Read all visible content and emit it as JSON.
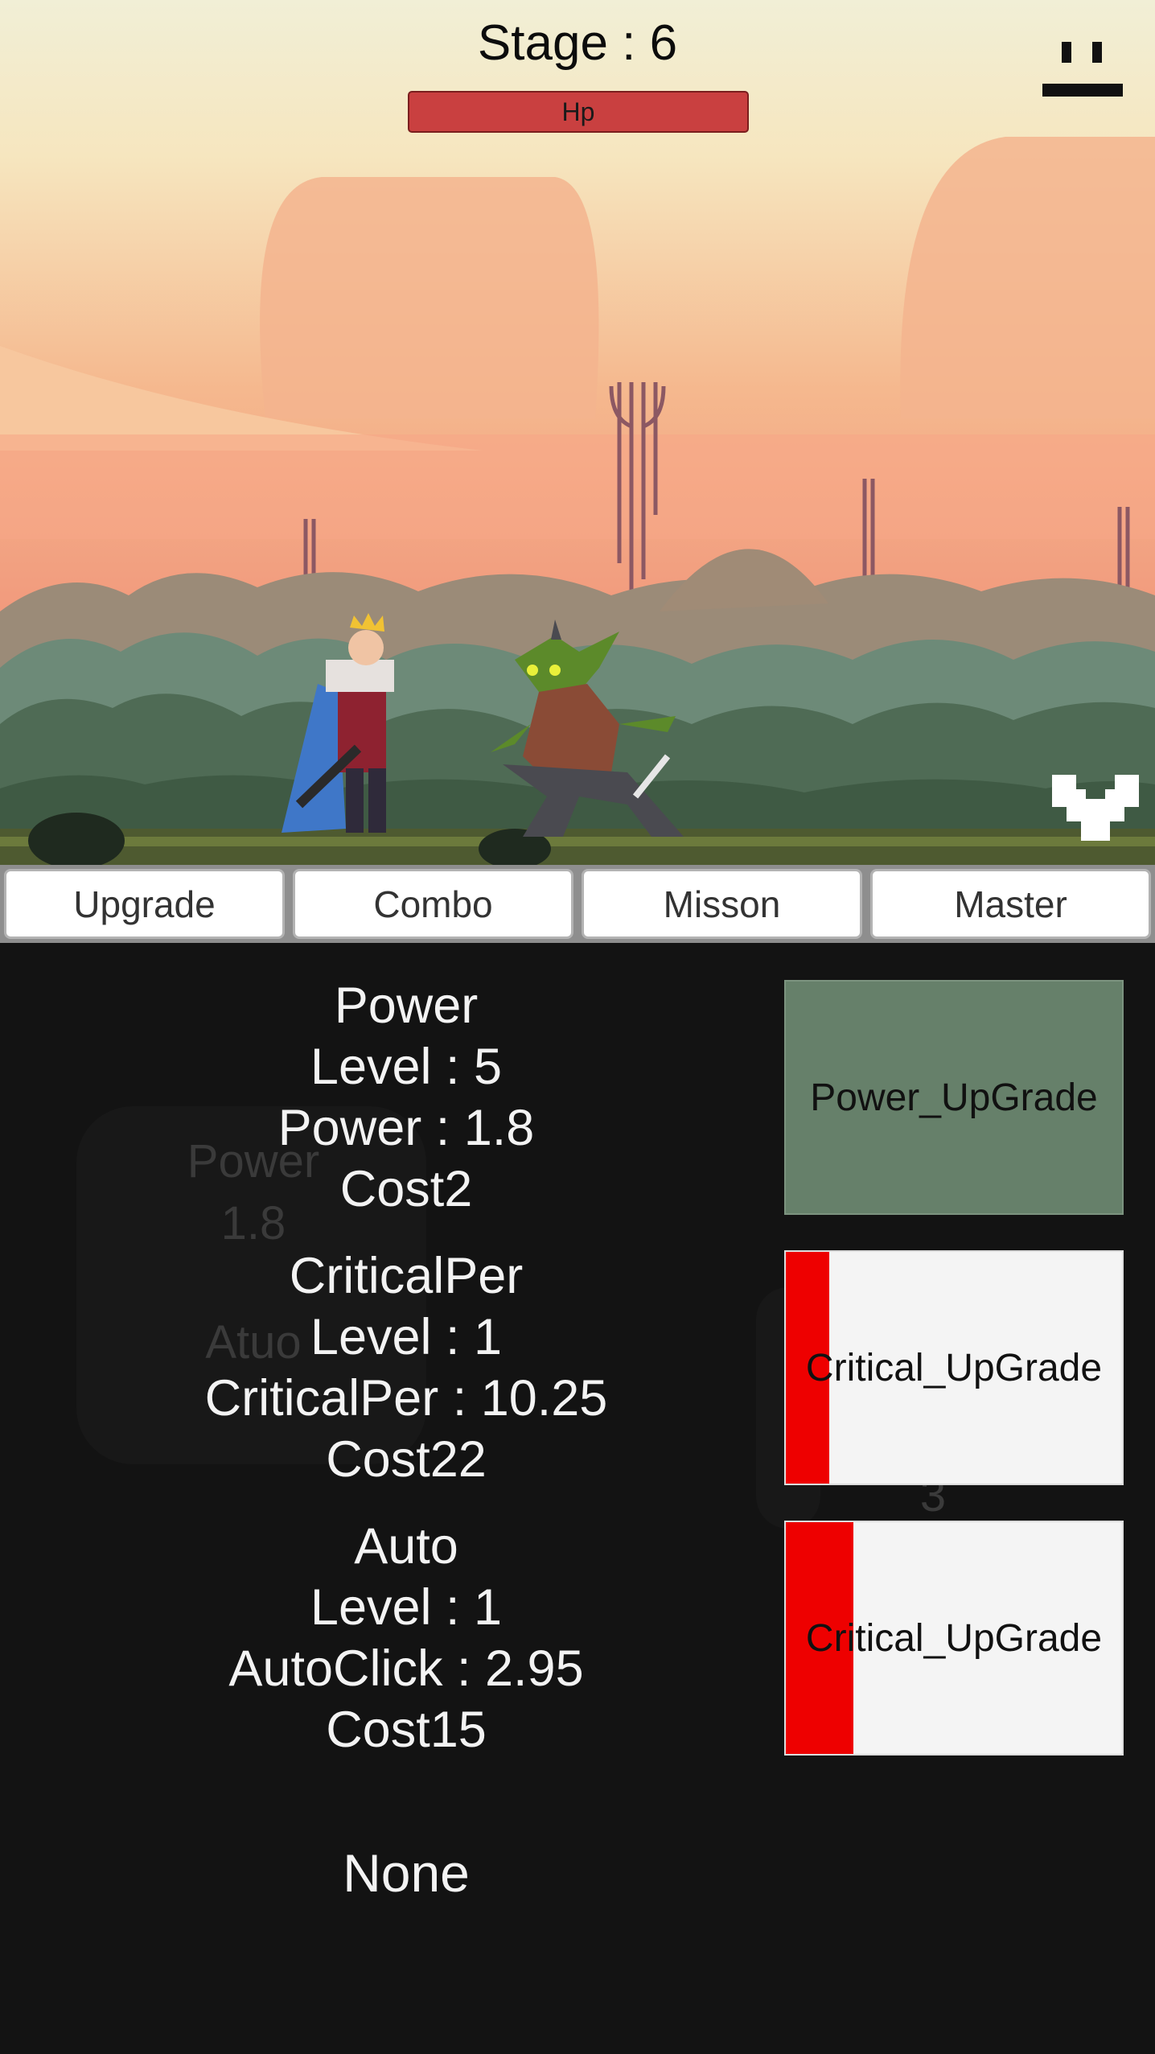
{
  "stage": {
    "label": "Stage : 6"
  },
  "hp": {
    "label": "Hp",
    "fill_fraction": 1.0,
    "color": "#c94040"
  },
  "tabs": [
    {
      "label": "Upgrade"
    },
    {
      "label": "Combo"
    },
    {
      "label": "Misson"
    },
    {
      "label": "Master"
    }
  ],
  "stats": [
    {
      "name": "Power",
      "level": "Level : 5",
      "value": "Power : 1.8",
      "cost": "Cost2"
    },
    {
      "name": "CriticalPer",
      "level": "Level : 1",
      "value": "CriticalPer : 10.25",
      "cost": "Cost22"
    },
    {
      "name": "Auto",
      "level": "Level : 1",
      "value": "AutoClick : 2.95",
      "cost": "Cost15"
    }
  ],
  "upgrade_buttons": [
    {
      "label": "Power_UpGrade",
      "cooldown_fraction": 0.0,
      "bg": "#66806a"
    },
    {
      "label": "Critical_UpGrade",
      "cooldown_fraction": 0.13,
      "bg": "#f4f4f4"
    },
    {
      "label": "Critical_UpGrade",
      "cooldown_fraction": 0.2,
      "bg": "#f4f4f4"
    }
  ],
  "ghost_panel": {
    "line1": "Power",
    "line2": "1.8",
    "line3": "Atuo",
    "line4": "3"
  },
  "footer": {
    "label": "None"
  },
  "icons": {
    "pause": "pause-icon",
    "dropdown": "chevron-down-icon"
  }
}
